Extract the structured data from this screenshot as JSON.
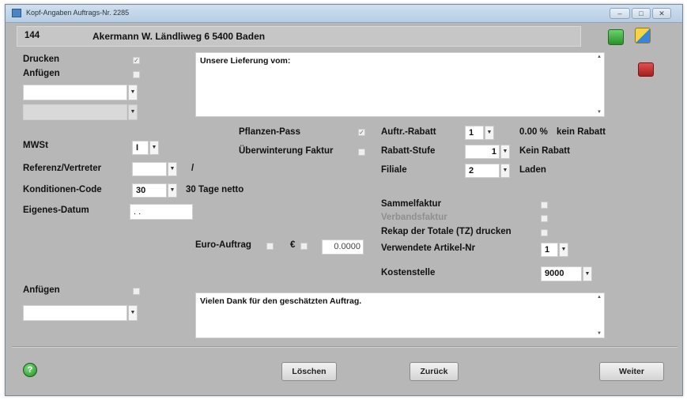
{
  "window": {
    "title": "Kopf-Angaben Auftrags-Nr. 2285",
    "icons": [
      "minimize-icon",
      "maximize-icon",
      "close-icon"
    ]
  },
  "header": {
    "number": "144",
    "address": "Akermann W. Ländliweg 6 5400 Baden"
  },
  "left": {
    "drucken_label": "Drucken",
    "anfuegen_label": "Anfügen",
    "mwst_label": "MWSt",
    "mwst_value": "I",
    "referenz_label": "Referenz/Vertreter",
    "referenz_value": "",
    "referenz_suffix": "/",
    "konditionen_label": "Konditionen-Code",
    "konditionen_value": "30",
    "konditionen_text": "30 Tage netto",
    "eigenes_datum_label": "Eigenes-Datum",
    "eigenes_datum_value": ". .",
    "anfuegen2_label": "Anfügen"
  },
  "memo_top": {
    "text": "Unsere Lieferung vom:"
  },
  "memo_bottom": {
    "text": "Vielen Dank für den geschätzten Auftrag."
  },
  "middle": {
    "pflanzen_pass_label": "Pflanzen-Pass",
    "ueberwinterung_label": "Überwinterung Faktur",
    "euro_auftrag_label": "Euro-Auftrag",
    "euro_symbol": "€",
    "euro_value": "0.0000"
  },
  "right": {
    "auftr_rabatt_label": "Auftr.-Rabatt",
    "auftr_rabatt_value": "1",
    "auftr_rabatt_percent": "0.00 %",
    "auftr_rabatt_text": "kein Rabatt",
    "rabatt_stufe_label": "Rabatt-Stufe",
    "rabatt_stufe_value": "1",
    "rabatt_stufe_text": "Kein Rabatt",
    "filiale_label": "Filiale",
    "filiale_value": "2",
    "filiale_text": "Laden",
    "sammelfaktur_label": "Sammelfaktur",
    "verbandsfaktur_label": "Verbandsfaktur",
    "rekap_label": "Rekap der Totale (TZ) drucken",
    "artikel_nr_label": "Verwendete Artikel-Nr",
    "artikel_nr_value": "1",
    "kostenstelle_label": "Kostenstelle",
    "kostenstelle_value": "9000"
  },
  "footer": {
    "loeschen": "Löschen",
    "zurueck": "Zurück",
    "weiter": "Weiter"
  },
  "colors": {
    "window_bg": "#b7b7b7",
    "green_icon": "#3aa33a",
    "yellow_icon": "#e8c21a",
    "red_icon": "#c62828"
  }
}
